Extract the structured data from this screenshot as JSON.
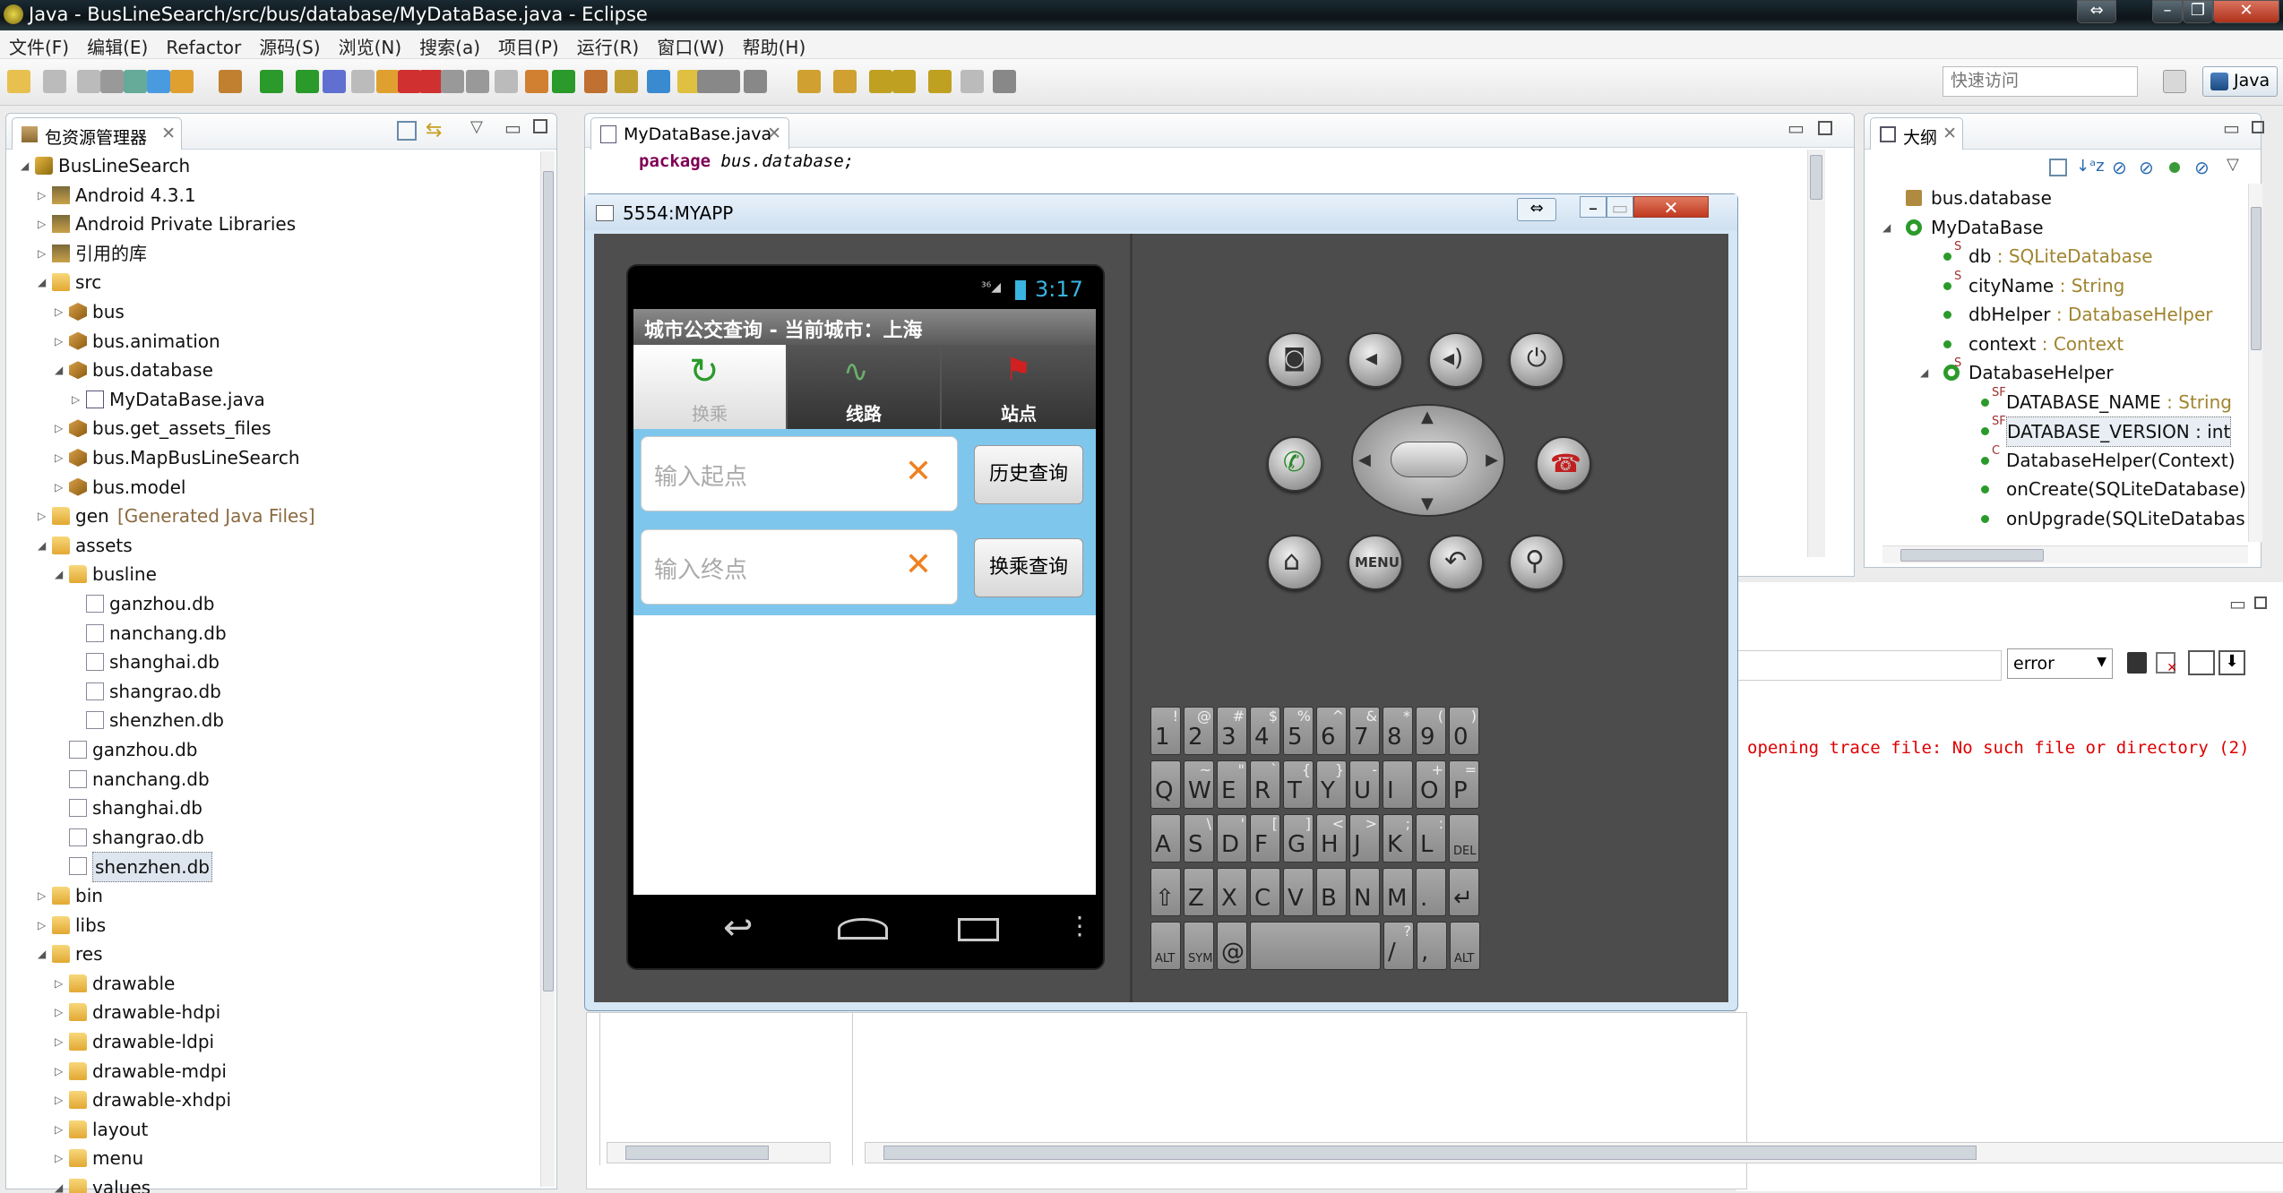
{
  "window": {
    "title": "Java - BusLineSearch/src/bus/database/MyDataBase.java - Eclipse"
  },
  "menu": [
    "文件(F)",
    "编辑(E)",
    "Refactor",
    "源码(S)",
    "浏览(N)",
    "搜索(a)",
    "项目(P)",
    "运行(R)",
    "窗口(W)",
    "帮助(H)"
  ],
  "quick_access": {
    "placeholder": "快速访问"
  },
  "perspective": "Java",
  "package_explorer": {
    "title": "包资源管理器",
    "items": [
      {
        "label": "BusLineSearch",
        "level": 0,
        "icon": "project-icon",
        "open": true
      },
      {
        "label": "Android 4.3.1",
        "level": 1,
        "icon": "library-icon"
      },
      {
        "label": "Android Private Libraries",
        "level": 1,
        "icon": "library-icon"
      },
      {
        "label": "引用的库",
        "level": 1,
        "icon": "library-icon"
      },
      {
        "label": "src",
        "level": 1,
        "icon": "source-folder-icon",
        "open": true
      },
      {
        "label": "bus",
        "level": 2,
        "icon": "package-icon"
      },
      {
        "label": "bus.animation",
        "level": 2,
        "icon": "package-icon"
      },
      {
        "label": "bus.database",
        "level": 2,
        "icon": "package-icon",
        "open": true
      },
      {
        "label": "MyDataBase.java",
        "level": 3,
        "icon": "java-file-icon"
      },
      {
        "label": "bus.get_assets_files",
        "level": 2,
        "icon": "package-icon"
      },
      {
        "label": "bus.MapBusLineSearch",
        "level": 2,
        "icon": "package-icon"
      },
      {
        "label": "bus.model",
        "level": 2,
        "icon": "package-icon"
      },
      {
        "label": "gen",
        "suffix": "[Generated Java Files]",
        "level": 1,
        "icon": "source-folder-icon"
      },
      {
        "label": "assets",
        "level": 1,
        "icon": "folder-icon",
        "open": true
      },
      {
        "label": "busline",
        "level": 2,
        "icon": "folder-icon",
        "open": true
      },
      {
        "label": "ganzhou.db",
        "level": 3,
        "icon": "file-icon"
      },
      {
        "label": "nanchang.db",
        "level": 3,
        "icon": "file-icon"
      },
      {
        "label": "shanghai.db",
        "level": 3,
        "icon": "file-icon"
      },
      {
        "label": "shangrao.db",
        "level": 3,
        "icon": "file-icon"
      },
      {
        "label": "shenzhen.db",
        "level": 3,
        "icon": "file-icon"
      },
      {
        "label": "ganzhou.db",
        "level": 2,
        "icon": "file-icon"
      },
      {
        "label": "nanchang.db",
        "level": 2,
        "icon": "file-icon"
      },
      {
        "label": "shanghai.db",
        "level": 2,
        "icon": "file-icon"
      },
      {
        "label": "shangrao.db",
        "level": 2,
        "icon": "file-icon"
      },
      {
        "label": "shenzhen.db",
        "level": 2,
        "icon": "file-icon",
        "selected": true
      },
      {
        "label": "bin",
        "level": 1,
        "icon": "folder-icon"
      },
      {
        "label": "libs",
        "level": 1,
        "icon": "folder-icon"
      },
      {
        "label": "res",
        "level": 1,
        "icon": "folder-icon",
        "open": true
      },
      {
        "label": "drawable",
        "level": 2,
        "icon": "folder-icon"
      },
      {
        "label": "drawable-hdpi",
        "level": 2,
        "icon": "folder-icon"
      },
      {
        "label": "drawable-ldpi",
        "level": 2,
        "icon": "folder-icon"
      },
      {
        "label": "drawable-mdpi",
        "level": 2,
        "icon": "folder-icon"
      },
      {
        "label": "drawable-xhdpi",
        "level": 2,
        "icon": "folder-icon"
      },
      {
        "label": "layout",
        "level": 2,
        "icon": "folder-icon"
      },
      {
        "label": "menu",
        "level": 2,
        "icon": "folder-icon"
      },
      {
        "label": "values",
        "level": 2,
        "icon": "folder-icon",
        "open": true
      }
    ]
  },
  "editor": {
    "tab": "MyDataBase.java",
    "code_keyword": "package",
    "code_rest": " bus.database;"
  },
  "outline": {
    "title": "大纲",
    "items": [
      {
        "label": "bus.database",
        "type": "",
        "level": 0,
        "icon": "package-icon"
      },
      {
        "label": "MyDataBase",
        "type": "",
        "level": 0,
        "icon": "class-icon",
        "open": true
      },
      {
        "label": "db",
        "type": " : SQLiteDatabase",
        "level": 1,
        "icon": "field-icon",
        "mod": "S"
      },
      {
        "label": "cityName",
        "type": " : String",
        "level": 1,
        "icon": "field-icon",
        "mod": "S"
      },
      {
        "label": "dbHelper",
        "type": " : DatabaseHelper",
        "level": 1,
        "icon": "field-icon"
      },
      {
        "label": "context",
        "type": " : Context",
        "level": 1,
        "icon": "field-icon"
      },
      {
        "label": "DatabaseHelper",
        "type": "",
        "level": 1,
        "icon": "class-icon",
        "mod": "S",
        "open": true
      },
      {
        "label": "DATABASE_NAME",
        "type": " : String",
        "level": 2,
        "icon": "constant-icon",
        "mod": "SF"
      },
      {
        "label": "DATABASE_VERSION : int",
        "type": "",
        "level": 2,
        "icon": "constant-icon",
        "mod": "SF",
        "selected": true
      },
      {
        "label": "DatabaseHelper(Context)",
        "type": "",
        "level": 2,
        "icon": "constructor-icon",
        "mod": "C"
      },
      {
        "label": "onCreate(SQLiteDatabase)",
        "type": "",
        "level": 2,
        "icon": "method-icon"
      },
      {
        "label": "onUpgrade(SQLiteDatabas",
        "type": "",
        "level": 2,
        "icon": "method-icon"
      }
    ]
  },
  "console": {
    "filter": "error",
    "message": "opening trace file: No such file or directory (2)"
  },
  "emulator": {
    "title": "5554:MYAPP",
    "status_time": "3:17",
    "app_title": "城市公交查询 - 当前城市：上海",
    "tabs": [
      "换乘",
      "线路",
      "站点"
    ],
    "start_placeholder": "输入起点",
    "end_placeholder": "输入终点",
    "history_button": "历史查询",
    "transfer_button": "换乘查询",
    "menu_label": "MENU",
    "keys_row1": [
      [
        "1",
        "!"
      ],
      [
        "2",
        "@"
      ],
      [
        "3",
        "#"
      ],
      [
        "4",
        "$"
      ],
      [
        "5",
        "%"
      ],
      [
        "6",
        "^"
      ],
      [
        "7",
        "&"
      ],
      [
        "8",
        "*"
      ],
      [
        "9",
        "("
      ],
      [
        "0",
        ")"
      ]
    ],
    "keys_row2": [
      [
        "Q",
        ""
      ],
      [
        "W",
        "~"
      ],
      [
        "E",
        "\""
      ],
      [
        "R",
        "`"
      ],
      [
        "T",
        "{"
      ],
      [
        "Y",
        "}"
      ],
      [
        "U",
        "-"
      ],
      [
        "I",
        ""
      ],
      [
        "O",
        "+"
      ],
      [
        "P",
        "="
      ]
    ],
    "keys_row3": [
      [
        "A",
        ""
      ],
      [
        "S",
        "\\"
      ],
      [
        "D",
        "'"
      ],
      [
        "F",
        "["
      ],
      [
        "G",
        "]"
      ],
      [
        "H",
        "<"
      ],
      [
        "J",
        ">"
      ],
      [
        "K",
        ";"
      ],
      [
        "L",
        ":"
      ],
      [
        "DEL",
        ""
      ]
    ],
    "keys_row4": [
      [
        "⇧",
        ""
      ],
      [
        "Z",
        ""
      ],
      [
        "X",
        ""
      ],
      [
        "C",
        ""
      ],
      [
        "V",
        ""
      ],
      [
        "B",
        ""
      ],
      [
        "N",
        ""
      ],
      [
        "M",
        ""
      ],
      [
        ".",
        ""
      ],
      [
        "↵",
        ""
      ]
    ],
    "keys_row5": [
      [
        "ALT",
        ""
      ],
      [
        "SYM",
        ""
      ],
      [
        "@",
        ""
      ],
      [
        "",
        ""
      ],
      [
        "/",
        "?"
      ],
      [
        ",",
        ""
      ],
      [
        "ALT",
        ""
      ]
    ]
  }
}
